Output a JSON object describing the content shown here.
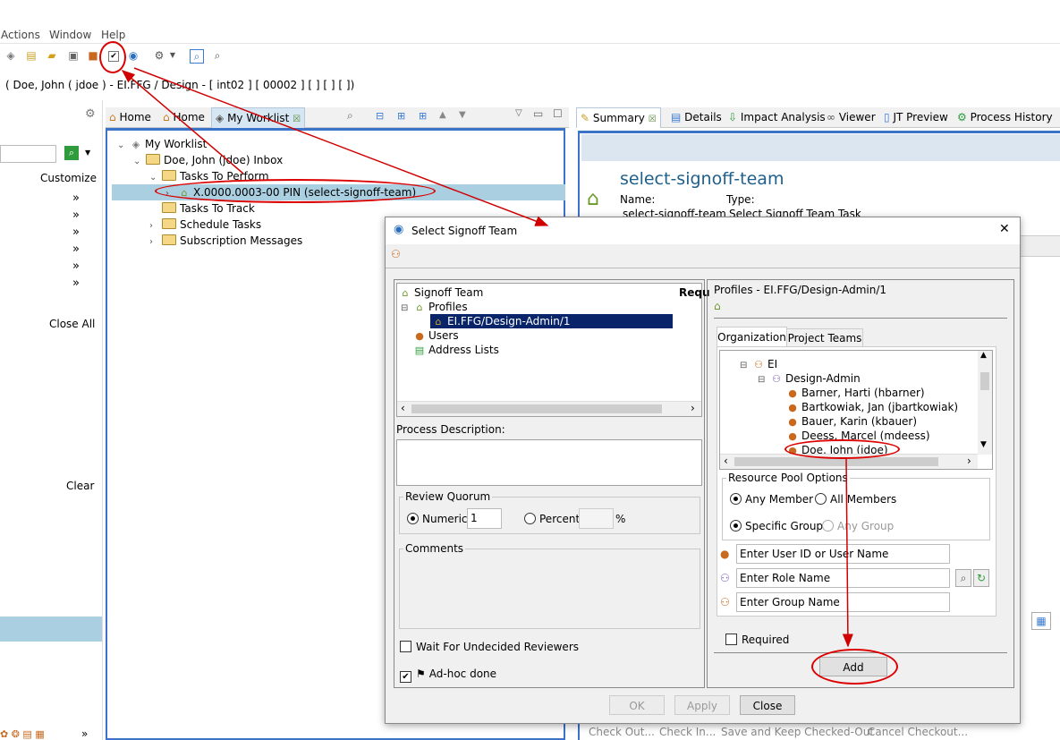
{
  "menu": [
    "Actions",
    "Window",
    "Help"
  ],
  "toolbar_icons": [
    "tag-icon",
    "paste-icon",
    "open-icon",
    "lock-icon",
    "checkout-icon",
    "signoff-checkbox-icon",
    "globe-icon",
    "gear-icon",
    "search-window-icon",
    "search-icon"
  ],
  "context_line": "( Doe, John ( jdoe ) - EI.FFG / Design - [ int02 ] [ 00002 ] [ ] [  ]  [  ])",
  "left_pane": {
    "customize": "Customize",
    "close_all": "Close All",
    "clear": "Clear",
    "chevron": "»"
  },
  "worklist_view": {
    "tabs": [
      "Home",
      "Home",
      "My Worklist"
    ],
    "tree": [
      {
        "label": "My Worklist"
      },
      {
        "label": "Doe, John (jdoe) Inbox"
      },
      {
        "label": "Tasks To Perform"
      },
      {
        "label": "X.0000.0003-00 PIN (select-signoff-team)"
      },
      {
        "label": "Tasks To Track"
      },
      {
        "label": "Schedule Tasks"
      },
      {
        "label": "Subscription Messages"
      }
    ]
  },
  "summary_view": {
    "tabs": [
      "Summary",
      "Details",
      "Impact Analysis",
      "Viewer",
      "JT Preview",
      "Process History"
    ],
    "title": "select-signoff-team",
    "name_label": "Name:",
    "name_value": "select-signoff-team",
    "type_label": "Type:",
    "type_value": "Select Signoff Team Task",
    "bottom_actions": [
      "Check Out...",
      "Check In...",
      "Save and Keep Checked-Out",
      "Cancel Checkout..."
    ]
  },
  "dialog": {
    "title": "Select Signoff Team",
    "close_glyph": "✕",
    "team_tree": {
      "root": "Signoff Team",
      "profiles": "Profiles",
      "profile_item": "EI.FFG/Design-Admin/1",
      "users": "Users",
      "address_lists": "Address Lists",
      "req_header": "Requ"
    },
    "process_description_label": "Process Description:",
    "review_quorum": {
      "title": "Review Quorum",
      "numeric_label": "Numeric",
      "numeric_value": "1",
      "percent_label": "Percent",
      "percent_suffix": "%",
      "selected": "numeric"
    },
    "comments_label": "Comments",
    "wait_for_undecided": {
      "label": "Wait For Undecided Reviewers",
      "checked": false
    },
    "adhoc_done": {
      "label": "Ad-hoc done",
      "checked": true
    },
    "profiles_header": "Profiles - EI.FFG/Design-Admin/1",
    "org_tabs": [
      "Organization",
      "Project Teams"
    ],
    "org_tree": [
      {
        "label": "EI"
      },
      {
        "label": "Design-Admin"
      },
      {
        "label": "Barner, Harti (hbarner)"
      },
      {
        "label": "Bartkowiak, Jan (jbartkowiak)"
      },
      {
        "label": "Bauer, Karin (kbauer)"
      },
      {
        "label": "Deess, Marcel (mdeess)"
      },
      {
        "label": "Doe, John (jdoe)"
      }
    ],
    "resource_pool": {
      "title": "Resource Pool Options",
      "any_member": "Any Member",
      "all_members": "All Members",
      "specific_group": "Specific Group",
      "any_group": "Any Group"
    },
    "user_id_placeholder": "Enter User ID or User Name",
    "role_placeholder": "Enter Role Name",
    "group_placeholder": "Enter Group Name",
    "required": {
      "label": "Required",
      "checked": false
    },
    "add_label": "Add",
    "buttons": {
      "ok": "OK",
      "apply": "Apply",
      "close": "Close"
    }
  },
  "colors": {
    "annotation_red": "#d00000",
    "selection_blue": "#0a246a",
    "view_border": "#3b73c8",
    "title_blue": "#1f5f8b"
  }
}
